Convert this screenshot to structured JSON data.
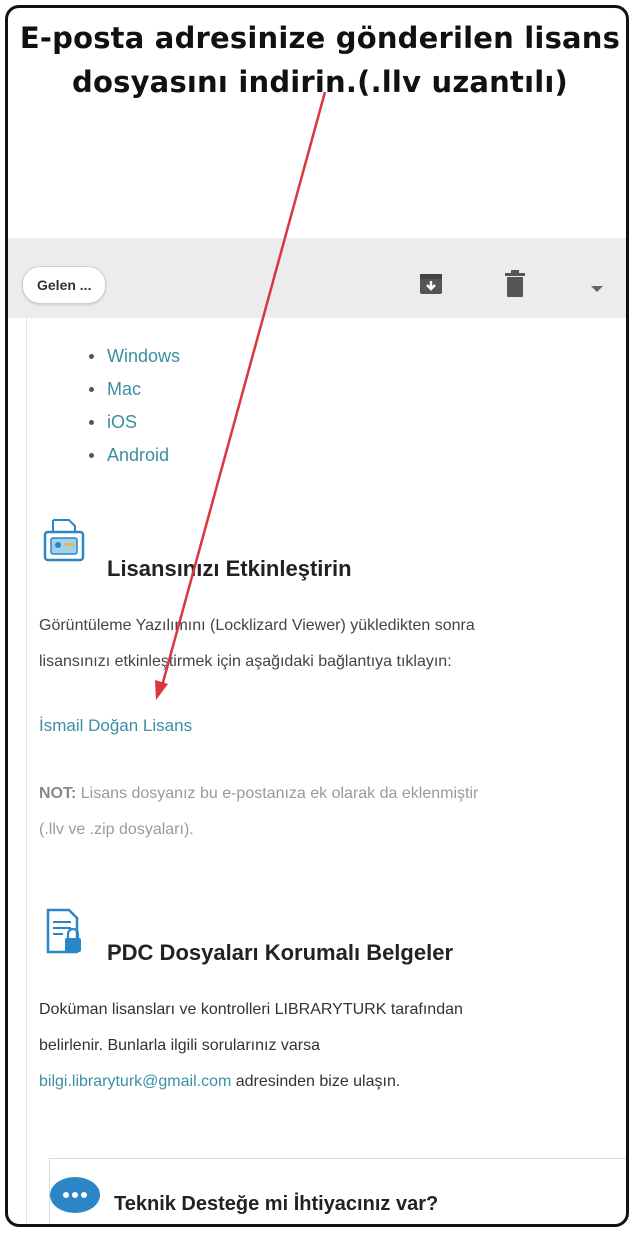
{
  "headline": {
    "line1": "E-posta  adresinize gönderilen lisans",
    "line2": "dosyasını indirin.(.llv uzantılı)"
  },
  "toolbar": {
    "back_label": "Gelen ...",
    "icons": [
      "archive-icon",
      "trash-icon",
      "dropdown-icon"
    ]
  },
  "platforms": [
    "Windows",
    "Mac",
    "iOS",
    "Android"
  ],
  "activate": {
    "title": "Lisansınızı Etkinleştirin",
    "text_line1": "Görüntüleme Yazılımını (Locklizard Viewer) yükledikten sonra",
    "text_line2": "lisansınızı etkinleştirmek için aşağıdaki bağlantıya tıklayın:",
    "link": "İsmail Doğan Lisans",
    "note_label": "NOT:",
    "note_line1": "Lisans dosyanız bu e-postanıza ek olarak da eklenmiştir",
    "note_line2": "(.llv ve .zip dosyaları)."
  },
  "protected": {
    "title": "PDC Dosyaları Korumalı Belgeler",
    "text_line1": "Doküman lisansları ve kontrolleri LIBRARYTURK tarafından",
    "text_line2": "belirlenir. Bunlarla ilgili sorularınız varsa",
    "email": "bilgi.libraryturk@gmail.com",
    "text_line3_rest": " adresinden bize ulaşın."
  },
  "footer_card": {
    "title": "Teknik Desteğe mi İhtiyacınız var?"
  },
  "colors": {
    "accent_teal": "#3a8fa5",
    "arrow_red": "#d9363e",
    "icon_blue": "#2b86c8"
  }
}
